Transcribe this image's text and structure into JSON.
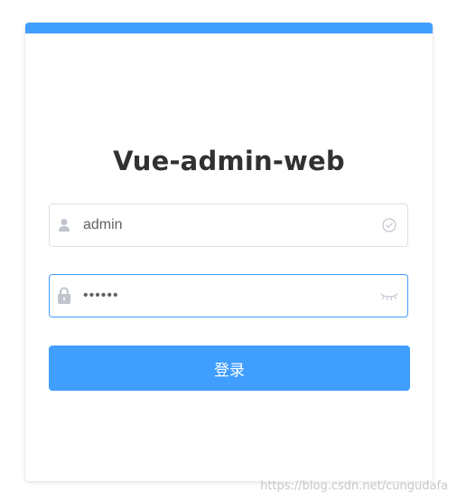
{
  "colors": {
    "accent": "#409eff",
    "title": "#303133",
    "input_border": "#dcdfe6",
    "input_focus_border": "#409eff",
    "icon": "#c0c4cc"
  },
  "login": {
    "title": "Vue-admin-web",
    "username": {
      "icon": "user-icon",
      "value": "admin",
      "suffix_icon": "circle-check-icon"
    },
    "password": {
      "icon": "lock-icon",
      "value": "••••••",
      "suffix_icon": "eye-closed-icon"
    },
    "submit_label": "登录"
  },
  "watermark": "https://blog.csdn.net/cungudafa"
}
